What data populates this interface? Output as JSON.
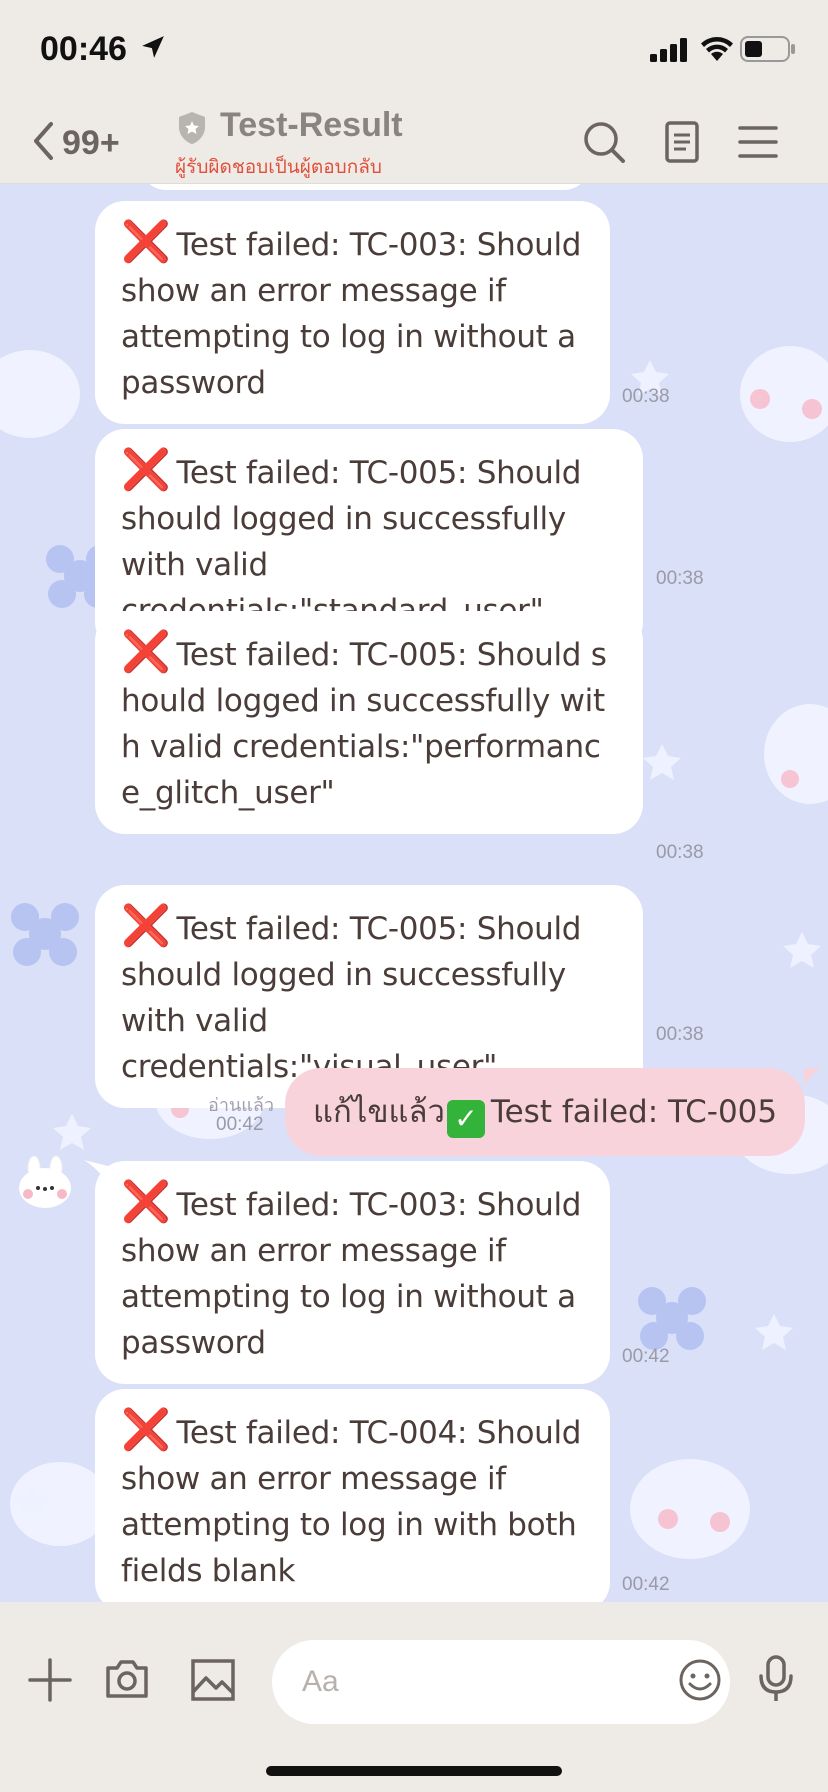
{
  "status_bar": {
    "time": "00:46"
  },
  "header": {
    "back_count": "99+",
    "title": "Test-Result",
    "subtitle": "ผู้รับผิดชอบเป็นผู้ตอบกลับ"
  },
  "messages": [
    {
      "type": "received",
      "text": "Test failed: TC-003: Should show an error message if attempting to log in without a password",
      "time": "00:38"
    },
    {
      "type": "received",
      "text": "Test failed: TC-005: Should should logged in successfully with valid credentials:\"standard_user\"",
      "time": "00:38"
    },
    {
      "type": "received",
      "text": "Test failed: TC-005: Should should logged in successfully with valid credentials:\"performance_glitch_user\"",
      "time": "00:38"
    },
    {
      "type": "received",
      "text": "Test failed: TC-005: Should should logged in successfully with valid credentials:\"visual_user\"",
      "time": "00:38"
    },
    {
      "type": "sent",
      "prefix": "แก้ไขแล้ว",
      "text": "Test failed: TC-005",
      "read_label": "อ่านแล้ว",
      "time": "00:42"
    },
    {
      "type": "received",
      "text": "Test failed: TC-003: Should show an error message if attempting to log in without a password",
      "time": "00:42"
    },
    {
      "type": "received",
      "text": "Test failed: TC-004: Should show an error message if attempting to log in with both fields blank",
      "time": "00:42"
    }
  ],
  "input_bar": {
    "placeholder": "Aa"
  },
  "icons": {
    "fail_mark": "❌",
    "check_mark": "✅"
  },
  "colors": {
    "chat_background": "#d9e0f7",
    "sent_bubble": "#f9d3dc",
    "fail_red": "#e0202a",
    "subtitle_red": "#e0503c"
  }
}
